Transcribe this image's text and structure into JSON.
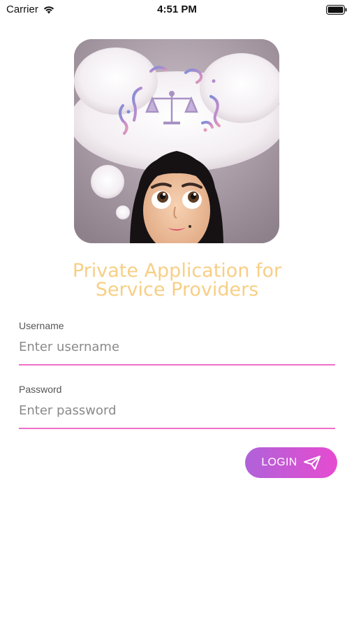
{
  "status_bar": {
    "carrier": "Carrier",
    "time": "4:51 PM",
    "icons": [
      "wifi-icon",
      "battery-icon"
    ]
  },
  "logo": {
    "icon": "avatar-thought-bubble-scales-logo"
  },
  "title": {
    "line1": "Private Application for",
    "line2": "Service Providers",
    "color": "#f7cf85"
  },
  "form": {
    "username": {
      "label": "Username",
      "placeholder": "Enter username",
      "value": ""
    },
    "password": {
      "label": "Password",
      "placeholder": "Enter password",
      "value": ""
    },
    "underline_color": "#f06fc9"
  },
  "login_button": {
    "label": "LOGIN",
    "icon": "send-icon",
    "gradient": [
      "#b062d9",
      "#e64bd0"
    ]
  }
}
